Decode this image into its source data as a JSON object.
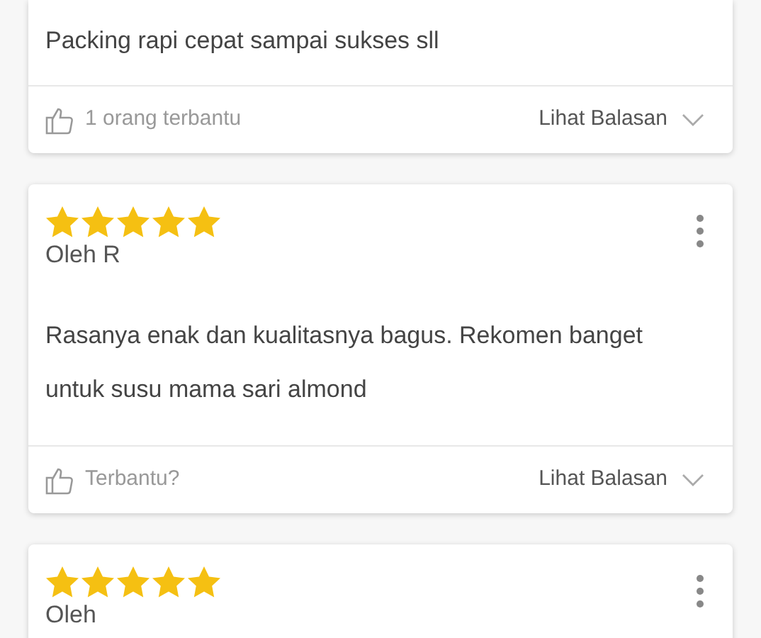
{
  "reviews": [
    {
      "text": "Packing rapi cepat sampai sukses sll",
      "helpful": "1 orang terbantu",
      "replies": "Lihat Balasan"
    },
    {
      "stars": 5,
      "author": "Oleh R",
      "text": "Rasanya enak dan kualitasnya bagus. Rekomen banget untuk susu mama sari almond",
      "helpful": "Terbantu?",
      "replies": "Lihat Balasan"
    },
    {
      "stars": 5,
      "author": "Oleh"
    }
  ]
}
